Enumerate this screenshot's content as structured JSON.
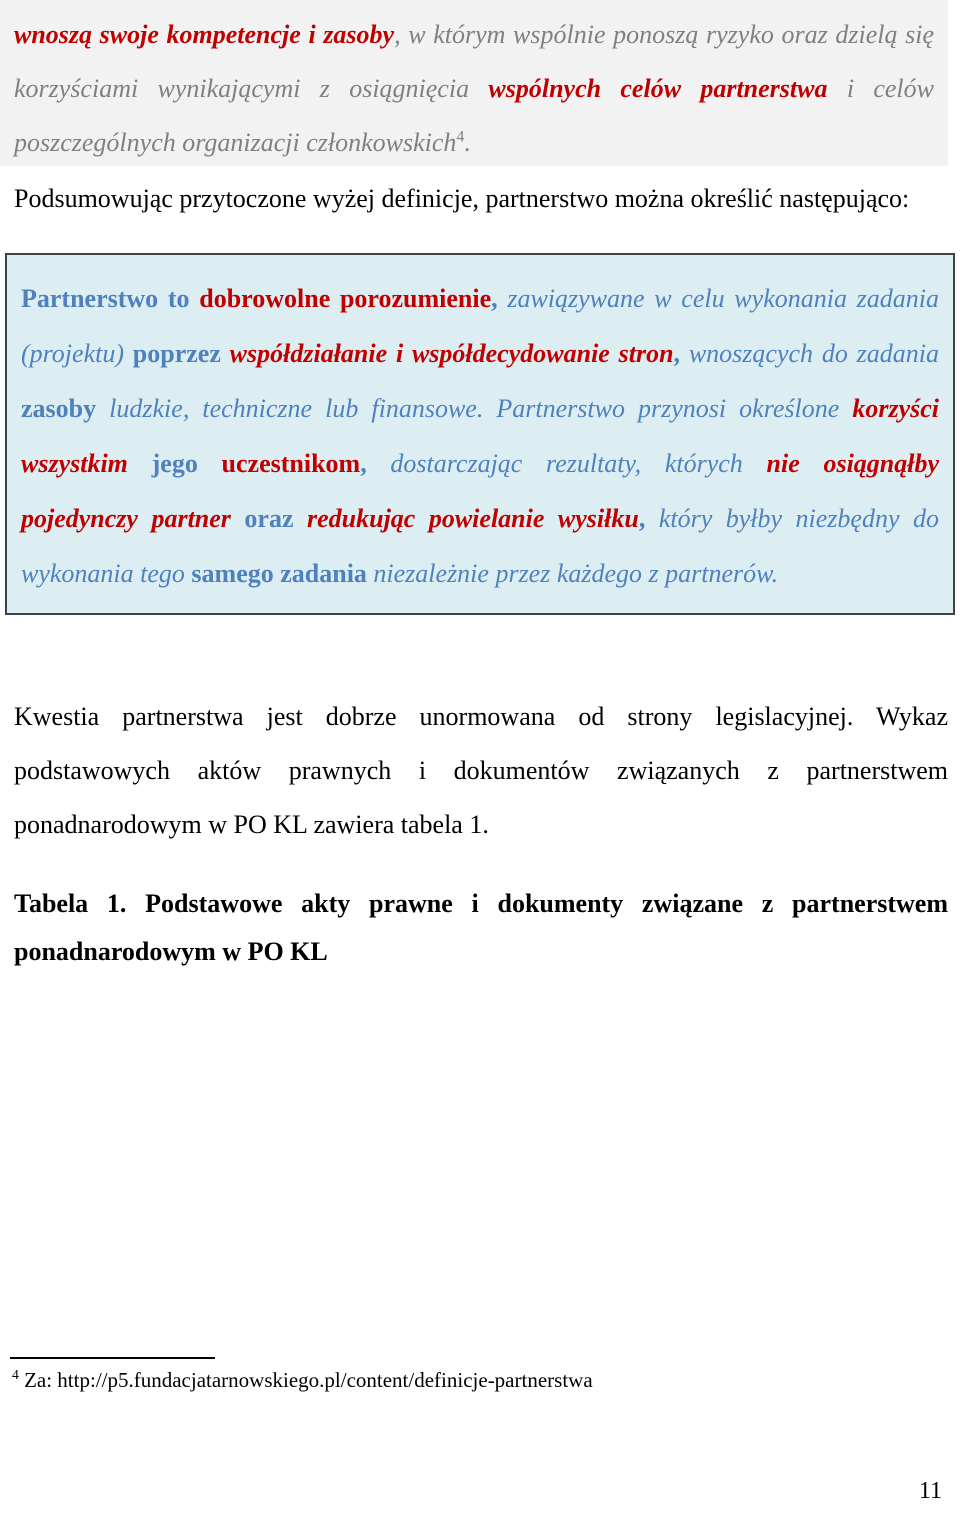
{
  "page": {
    "number": "11",
    "language": "pl"
  },
  "colors": {
    "quote_background": "#f2f2f2",
    "quote_text": "#808080",
    "accent_red": "#c00000",
    "definition_background": "#ddeef3",
    "definition_border": "#3c4348",
    "definition_blue": "#4e81bd",
    "body_text": "#000000"
  },
  "quote_block": {
    "footnote_marker": "4",
    "segments": [
      {
        "text": "wnoszą swoje kompetencje i zasoby",
        "style": "red-bold-italic"
      },
      {
        "text": ", w którym wspólnie ponoszą ryzyko oraz dzielą się korzyściami wynikającymi z osiągnięcia ",
        "style": "grey-italic"
      },
      {
        "text": "wspólnych celów partnerstwa",
        "style": "red-bold-italic"
      },
      {
        "text": " i celów poszczególnych organizacji członkowskich",
        "style": "grey-italic"
      },
      {
        "text": ".",
        "style": "grey-italic"
      }
    ]
  },
  "intro_paragraph": {
    "text": "Podsumowując przytoczone wyżej definicje, partnerstwo można określić następująco:"
  },
  "definition_box": {
    "segments": [
      {
        "text": "Partnerstwo to ",
        "style": "blue-bold"
      },
      {
        "text": "dobrowolne porozumienie",
        "style": "red-bold"
      },
      {
        "text": ", ",
        "style": "blue-bold"
      },
      {
        "text": "zawiązywane w celu wykonania zadania (projektu) ",
        "style": "blue-italic"
      },
      {
        "text": "poprzez ",
        "style": "blue-bold"
      },
      {
        "text": "współdziałanie i współdecydowanie stron",
        "style": "red-bold-italic"
      },
      {
        "text": ", ",
        "style": "blue-bold"
      },
      {
        "text": "wnoszących do zadania ",
        "style": "blue-italic"
      },
      {
        "text": "zasoby ",
        "style": "blue-bold"
      },
      {
        "text": "ludzkie, techniczne lub finansowe. Partnerstwo przynosi określone ",
        "style": "blue-italic"
      },
      {
        "text": "korzyści wszystkim",
        "style": "red-bold-italic"
      },
      {
        "text": " jego ",
        "style": "blue-bold"
      },
      {
        "text": "uczestnikom",
        "style": "red-bold"
      },
      {
        "text": ", ",
        "style": "blue-bold"
      },
      {
        "text": "dostarczając rezultaty, których ",
        "style": "blue-italic"
      },
      {
        "text": "nie osiągnąłby pojedynczy partner",
        "style": "red-bold-italic"
      },
      {
        "text": " oraz ",
        "style": "blue-bold"
      },
      {
        "text": "redukując powielanie wysiłku",
        "style": "red-bold-italic"
      },
      {
        "text": ", ",
        "style": "blue-bold"
      },
      {
        "text": "który byłby niezbędny do wykonania tego ",
        "style": "blue-italic"
      },
      {
        "text": "samego zadania ",
        "style": "blue-bold"
      },
      {
        "text": "niezależnie przez każdego z partnerów.",
        "style": "blue-italic"
      }
    ]
  },
  "body_paragraph": {
    "text": "Kwestia partnerstwa jest dobrze unormowana od strony legislacyjnej. Wykaz podstawowych aktów prawnych i dokumentów związanych z partnerstwem ponadnarodowym w PO KL zawiera tabela 1."
  },
  "table_caption": {
    "text": "Tabela 1. Podstawowe akty prawne i dokumenty związane z partnerstwem ponadnarodowym w PO KL"
  },
  "footnote": {
    "marker": "4",
    "text": " Za: http://p5.fundacjatarnowskiego.pl/content/definicje-partnerstwa"
  }
}
